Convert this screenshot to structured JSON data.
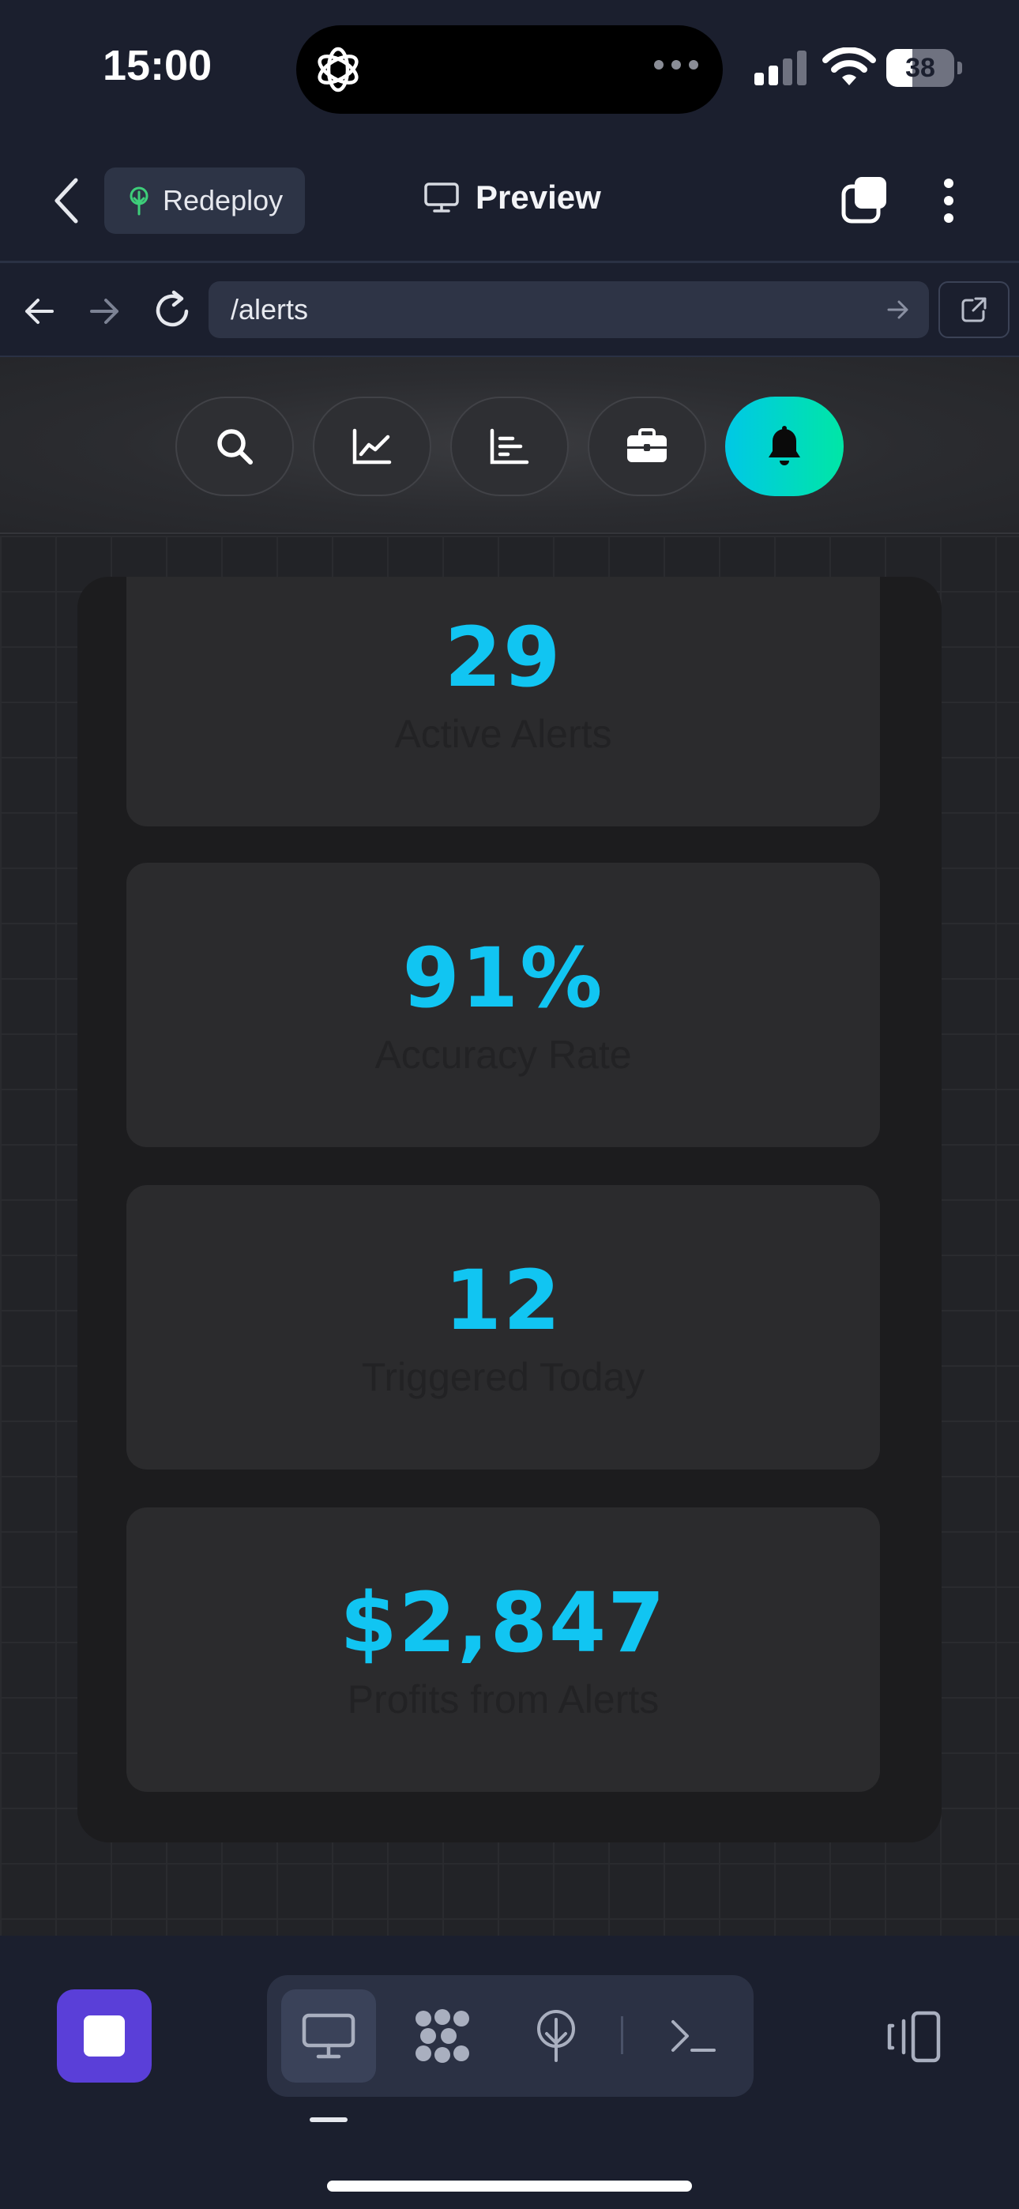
{
  "status_bar": {
    "time": "15:00",
    "battery": "38",
    "battery_level_percent": 38
  },
  "header": {
    "back_icon": "chevron-left-icon",
    "redeploy_label": "Redeploy",
    "preview_label": "Preview",
    "tabs_icon": "tabs-icon",
    "more_icon": "more-vertical-icon"
  },
  "browser": {
    "url": "/alerts"
  },
  "toolbar": {
    "buttons": [
      {
        "icon": "search-icon",
        "active": false
      },
      {
        "icon": "line-chart-icon",
        "active": false
      },
      {
        "icon": "bar-chart-icon",
        "active": false
      },
      {
        "icon": "briefcase-icon",
        "active": false
      },
      {
        "icon": "bell-icon",
        "active": true
      }
    ],
    "active_gradient": [
      "#00c8e6",
      "#00e6a6"
    ]
  },
  "stats": [
    {
      "value": "29",
      "label": "Active Alerts"
    },
    {
      "value": "91%",
      "label": "Accuracy Rate"
    },
    {
      "value": "12",
      "label": "Triggered Today"
    },
    {
      "value": "$2,847",
      "label": "Profits from Alerts"
    }
  ],
  "colors": {
    "accent": "#11c5f2",
    "stop_button": "#5a3fd8",
    "background": "#1b1f2e"
  },
  "dock": {
    "items": [
      "desktop-icon",
      "apps-icon",
      "deploy-icon",
      "terminal-icon"
    ],
    "active": "desktop-icon"
  }
}
